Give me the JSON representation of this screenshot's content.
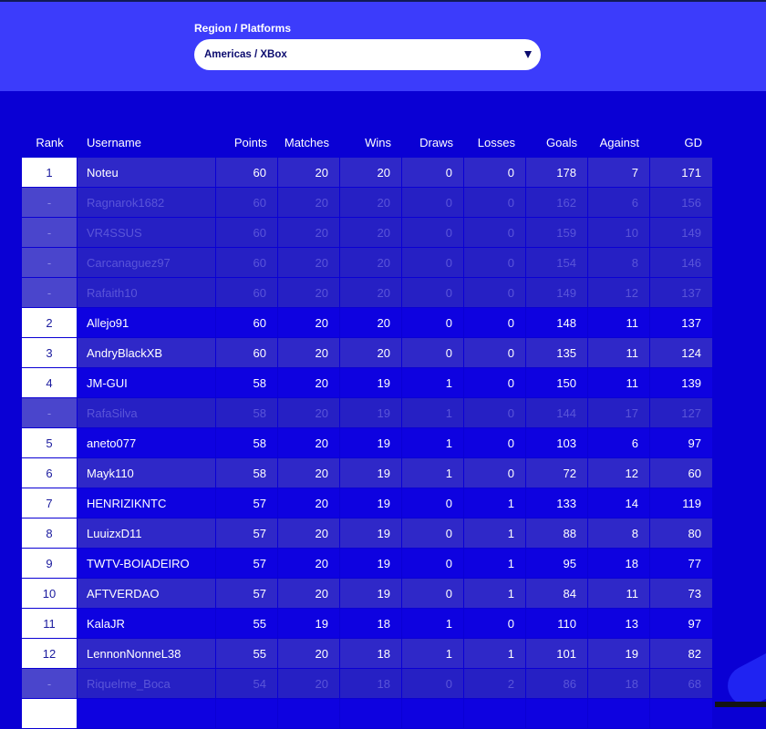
{
  "filter": {
    "label": "Region / Platforms",
    "value": "Americas / XBox"
  },
  "columns": [
    "Rank",
    "Username",
    "Points",
    "Matches",
    "Wins",
    "Draws",
    "Losses",
    "Goals",
    "Against",
    "GD"
  ],
  "rows": [
    {
      "rank": "1",
      "username": "Noteu",
      "points": "60",
      "matches": "20",
      "wins": "20",
      "draws": "0",
      "losses": "0",
      "goals": "178",
      "against": "7",
      "gd": "171",
      "style": "odd"
    },
    {
      "rank": "-",
      "username": "Ragnarok1682",
      "points": "60",
      "matches": "20",
      "wins": "20",
      "draws": "0",
      "losses": "0",
      "goals": "162",
      "against": "6",
      "gd": "156",
      "style": "sub"
    },
    {
      "rank": "-",
      "username": "VR4SSUS",
      "points": "60",
      "matches": "20",
      "wins": "20",
      "draws": "0",
      "losses": "0",
      "goals": "159",
      "against": "10",
      "gd": "149",
      "style": "sub"
    },
    {
      "rank": "-",
      "username": "Carcanaguez97",
      "points": "60",
      "matches": "20",
      "wins": "20",
      "draws": "0",
      "losses": "0",
      "goals": "154",
      "against": "8",
      "gd": "146",
      "style": "sub"
    },
    {
      "rank": "-",
      "username": "Rafaith10",
      "points": "60",
      "matches": "20",
      "wins": "20",
      "draws": "0",
      "losses": "0",
      "goals": "149",
      "against": "12",
      "gd": "137",
      "style": "sub"
    },
    {
      "rank": "2",
      "username": "Allejo91",
      "points": "60",
      "matches": "20",
      "wins": "20",
      "draws": "0",
      "losses": "0",
      "goals": "148",
      "against": "11",
      "gd": "137",
      "style": "even"
    },
    {
      "rank": "3",
      "username": "AndryBlackXB",
      "points": "60",
      "matches": "20",
      "wins": "20",
      "draws": "0",
      "losses": "0",
      "goals": "135",
      "against": "11",
      "gd": "124",
      "style": "odd"
    },
    {
      "rank": "4",
      "username": "JM-GUI",
      "points": "58",
      "matches": "20",
      "wins": "19",
      "draws": "1",
      "losses": "0",
      "goals": "150",
      "against": "11",
      "gd": "139",
      "style": "even"
    },
    {
      "rank": "-",
      "username": "RafaSilva",
      "points": "58",
      "matches": "20",
      "wins": "19",
      "draws": "1",
      "losses": "0",
      "goals": "144",
      "against": "17",
      "gd": "127",
      "style": "sub"
    },
    {
      "rank": "5",
      "username": "aneto077",
      "points": "58",
      "matches": "20",
      "wins": "19",
      "draws": "1",
      "losses": "0",
      "goals": "103",
      "against": "6",
      "gd": "97",
      "style": "even"
    },
    {
      "rank": "6",
      "username": "Mayk110",
      "points": "58",
      "matches": "20",
      "wins": "19",
      "draws": "1",
      "losses": "0",
      "goals": "72",
      "against": "12",
      "gd": "60",
      "style": "odd"
    },
    {
      "rank": "7",
      "username": "HENRIZIKNTC",
      "points": "57",
      "matches": "20",
      "wins": "19",
      "draws": "0",
      "losses": "1",
      "goals": "133",
      "against": "14",
      "gd": "119",
      "style": "even"
    },
    {
      "rank": "8",
      "username": "LuuizxD11",
      "points": "57",
      "matches": "20",
      "wins": "19",
      "draws": "0",
      "losses": "1",
      "goals": "88",
      "against": "8",
      "gd": "80",
      "style": "odd"
    },
    {
      "rank": "9",
      "username": "TWTV-BOIADEIRO",
      "points": "57",
      "matches": "20",
      "wins": "19",
      "draws": "0",
      "losses": "1",
      "goals": "95",
      "against": "18",
      "gd": "77",
      "style": "even"
    },
    {
      "rank": "10",
      "username": "AFTVERDAO",
      "points": "57",
      "matches": "20",
      "wins": "19",
      "draws": "0",
      "losses": "1",
      "goals": "84",
      "against": "11",
      "gd": "73",
      "style": "odd"
    },
    {
      "rank": "11",
      "username": "KalaJR",
      "points": "55",
      "matches": "19",
      "wins": "18",
      "draws": "1",
      "losses": "0",
      "goals": "110",
      "against": "13",
      "gd": "97",
      "style": "even"
    },
    {
      "rank": "12",
      "username": "LennonNonneL38",
      "points": "55",
      "matches": "20",
      "wins": "18",
      "draws": "1",
      "losses": "1",
      "goals": "101",
      "against": "19",
      "gd": "82",
      "style": "odd"
    },
    {
      "rank": "-",
      "username": "Riquelme_Boca",
      "points": "54",
      "matches": "20",
      "wins": "18",
      "draws": "0",
      "losses": "2",
      "goals": "86",
      "against": "18",
      "gd": "68",
      "style": "sub"
    },
    {
      "rank": "",
      "username": "",
      "points": "",
      "matches": "",
      "wins": "",
      "draws": "",
      "losses": "",
      "goals": "",
      "against": "",
      "gd": "",
      "style": "even"
    }
  ]
}
